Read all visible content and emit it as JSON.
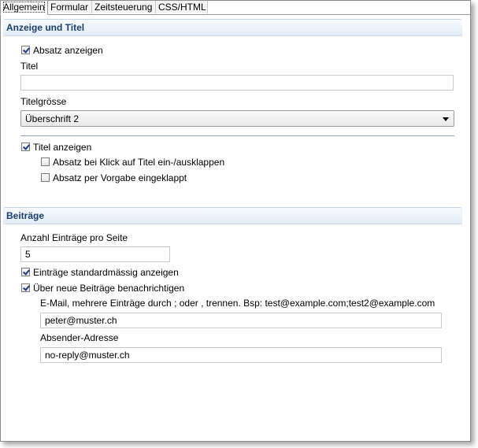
{
  "tabs": [
    "Allgemein",
    "Formular",
    "Zeitsteuerung",
    "CSS/HTML"
  ],
  "section_display": {
    "title": "Anzeige und Titel",
    "show_paragraph": {
      "label": "Absatz anzeigen",
      "checked": true
    },
    "title_label": "Titel",
    "title_value": "",
    "title_size_label": "Titelgrösse",
    "title_size_value": "Überschrift 2",
    "show_title": {
      "label": "Titel anzeigen",
      "checked": true
    },
    "collapse_on_click": {
      "label": "Absatz bei Klick auf Titel ein-/ausklappen",
      "checked": false
    },
    "collapsed_default": {
      "label": "Absatz per Vorgabe eingeklappt",
      "checked": false
    }
  },
  "section_posts": {
    "title": "Beiträge",
    "per_page_label": "Anzahl Einträge pro Seite",
    "per_page_value": "5",
    "show_default": {
      "label": "Einträge standardmässig anzeigen",
      "checked": true
    },
    "notify": {
      "label": "Über neue Beiträge benachrichtigen",
      "checked": true
    },
    "email_label": "E-Mail, mehrere Einträge durch ; oder , trennen. Bsp: test@example.com;test2@example.com",
    "email_value": "peter@muster.ch",
    "sender_label": "Absender-Adresse",
    "sender_value": "no-reply@muster.ch"
  }
}
